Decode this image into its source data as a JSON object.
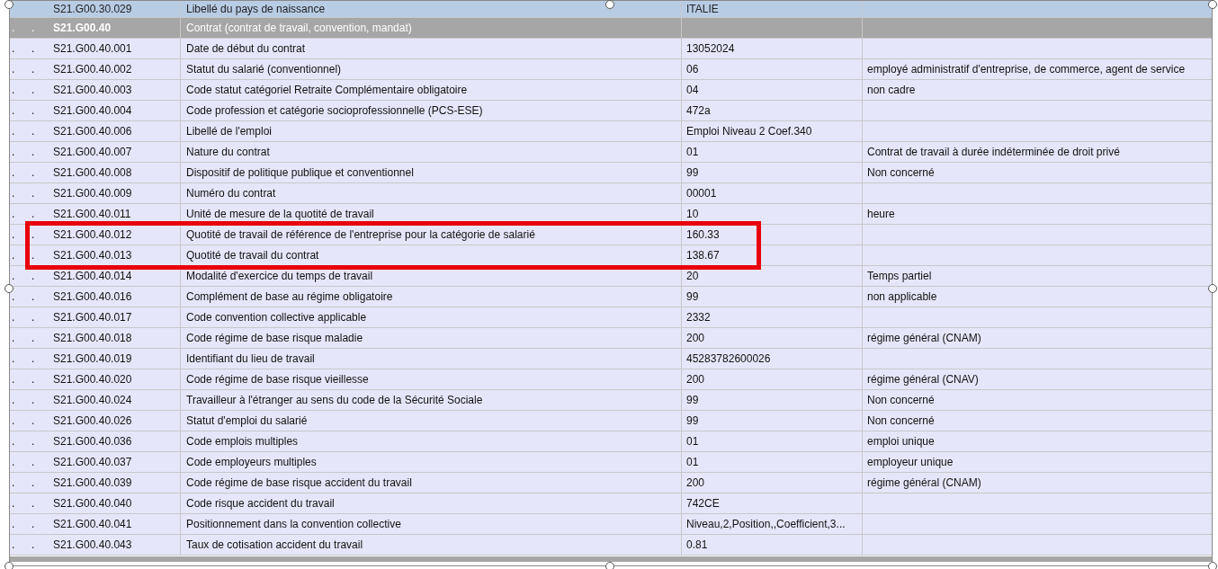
{
  "rows": [
    {
      "kind": "block",
      "dots": [],
      "code": "S21.G00.30.029",
      "label": "Libellé du pays de naissance",
      "value": "ITALIE",
      "description": ""
    },
    {
      "kind": "group",
      "dots": [
        ".",
        "."
      ],
      "code": "S21.G00.40",
      "label": "Contrat (contrat de travail, convention, mandat)",
      "value": "",
      "description": ""
    },
    {
      "kind": "field",
      "dots": [
        ".",
        "."
      ],
      "code": "S21.G00.40.001",
      "label": "Date de début du contrat",
      "value": "13052024",
      "description": ""
    },
    {
      "kind": "field",
      "dots": [
        ".",
        "."
      ],
      "code": "S21.G00.40.002",
      "label": "Statut du salarié (conventionnel)",
      "value": "06",
      "description": "employé administratif d'entreprise, de commerce, agent de service"
    },
    {
      "kind": "field",
      "dots": [
        ".",
        "."
      ],
      "code": "S21.G00.40.003",
      "label": "Code statut catégoriel Retraite Complémentaire obligatoire",
      "value": "04",
      "description": "non cadre"
    },
    {
      "kind": "field",
      "dots": [
        ".",
        "."
      ],
      "code": "S21.G00.40.004",
      "label": "Code profession et catégorie socioprofessionnelle (PCS-ESE)",
      "value": "472a",
      "description": ""
    },
    {
      "kind": "field",
      "dots": [
        ".",
        "."
      ],
      "code": "S21.G00.40.006",
      "label": "Libellé de l'emploi",
      "value": "Emploi Niveau 2 Coef.340",
      "description": ""
    },
    {
      "kind": "field",
      "dots": [
        ".",
        "."
      ],
      "code": "S21.G00.40.007",
      "label": "Nature du contrat",
      "value": "01",
      "description": "Contrat de travail à durée indéterminée de droit privé"
    },
    {
      "kind": "field",
      "dots": [
        ".",
        "."
      ],
      "code": "S21.G00.40.008",
      "label": "Dispositif de politique publique et conventionnel",
      "value": "99",
      "description": "Non concerné"
    },
    {
      "kind": "field",
      "dots": [
        ".",
        "."
      ],
      "code": "S21.G00.40.009",
      "label": "Numéro du contrat",
      "value": "00001",
      "description": ""
    },
    {
      "kind": "field",
      "dots": [
        ".",
        "."
      ],
      "code": "S21.G00.40.011",
      "label": "Unité de mesure de la quotité de travail",
      "value": "10",
      "description": "heure"
    },
    {
      "kind": "field",
      "dots": [
        ".",
        "."
      ],
      "code": "S21.G00.40.012",
      "label": "Quotité de travail de référence de l'entreprise pour la catégorie de salarié",
      "value": "160.33",
      "description": ""
    },
    {
      "kind": "field",
      "dots": [
        ".",
        "."
      ],
      "code": "S21.G00.40.013",
      "label": "Quotité de travail du contrat",
      "value": "138.67",
      "description": ""
    },
    {
      "kind": "field",
      "dots": [
        ".",
        "."
      ],
      "code": "S21.G00.40.014",
      "label": "Modalité d'exercice du temps de travail",
      "value": "20",
      "description": "Temps partiel"
    },
    {
      "kind": "field",
      "dots": [
        ".",
        "."
      ],
      "code": "S21.G00.40.016",
      "label": "Complément de base au régime obligatoire",
      "value": "99",
      "description": "non applicable"
    },
    {
      "kind": "field",
      "dots": [
        ".",
        "."
      ],
      "code": "S21.G00.40.017",
      "label": "Code convention collective applicable",
      "value": "2332",
      "description": ""
    },
    {
      "kind": "field",
      "dots": [
        ".",
        "."
      ],
      "code": "S21.G00.40.018",
      "label": "Code régime de base risque maladie",
      "value": "200",
      "description": "régime général (CNAM)"
    },
    {
      "kind": "field",
      "dots": [
        ".",
        "."
      ],
      "code": "S21.G00.40.019",
      "label": "Identifiant du lieu de travail",
      "value": "45283782600026",
      "description": ""
    },
    {
      "kind": "field",
      "dots": [
        ".",
        "."
      ],
      "code": "S21.G00.40.020",
      "label": "Code régime de base risque vieillesse",
      "value": "200",
      "description": "régime général (CNAV)"
    },
    {
      "kind": "field",
      "dots": [
        ".",
        "."
      ],
      "code": "S21.G00.40.024",
      "label": "Travailleur à l'étranger au sens du code de la Sécurité Sociale",
      "value": "99",
      "description": "Non concerné"
    },
    {
      "kind": "field",
      "dots": [
        ".",
        "."
      ],
      "code": "S21.G00.40.026",
      "label": "Statut d'emploi du salarié",
      "value": "99",
      "description": "Non concerné"
    },
    {
      "kind": "field",
      "dots": [
        ".",
        "."
      ],
      "code": "S21.G00.40.036",
      "label": "Code emplois multiples",
      "value": "01",
      "description": "emploi unique"
    },
    {
      "kind": "field",
      "dots": [
        ".",
        "."
      ],
      "code": "S21.G00.40.037",
      "label": "Code employeurs multiples",
      "value": "01",
      "description": "employeur unique"
    },
    {
      "kind": "field",
      "dots": [
        ".",
        "."
      ],
      "code": "S21.G00.40.039",
      "label": "Code régime de base risque accident du travail",
      "value": "200",
      "description": "régime général (CNAM)"
    },
    {
      "kind": "field",
      "dots": [
        ".",
        "."
      ],
      "code": "S21.G00.40.040",
      "label": "Code risque accident du travail",
      "value": "742CE",
      "description": ""
    },
    {
      "kind": "field",
      "dots": [
        ".",
        "."
      ],
      "code": "S21.G00.40.041",
      "label": "Positionnement dans la convention collective",
      "value": "Niveau,2,Position,,Coefficient,3...",
      "description": ""
    },
    {
      "kind": "field",
      "dots": [
        ".",
        "."
      ],
      "code": "S21.G00.40.043",
      "label": "Taux de cotisation accident du travail",
      "value": "0.81",
      "description": ""
    }
  ]
}
